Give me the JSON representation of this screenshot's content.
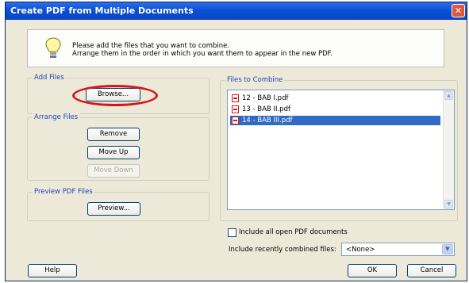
{
  "window": {
    "title": "Create PDF from Multiple Documents"
  },
  "info": {
    "line1": "Please add the files that you want to combine.",
    "line2": "Arrange them in the order in which you want them to appear in the new PDF."
  },
  "add_files": {
    "legend": "Add Files",
    "browse_label": "Browse..."
  },
  "arrange_files": {
    "legend": "Arrange Files",
    "remove_label": "Remove",
    "move_up_label": "Move Up",
    "move_down_label": "Move Down"
  },
  "preview": {
    "legend": "Preview PDF Files",
    "preview_label": "Preview..."
  },
  "files_to_combine": {
    "legend": "Files to Combine",
    "files": [
      "12 - BAB I.pdf",
      "13 - BAB II.pdf",
      "14 - BAB III.pdf"
    ],
    "selected_index": 2
  },
  "options": {
    "include_open_label": "Include all open PDF documents",
    "include_open_checked": false,
    "recent_label": "Include recently combined files:",
    "recent_value": "<None>"
  },
  "footer": {
    "help_label": "Help",
    "ok_label": "OK",
    "cancel_label": "Cancel"
  },
  "colors": {
    "title_bar": "#0a4fd6",
    "highlight_ring": "#d8141b",
    "selection": "#316ac5",
    "group_label": "#1e46b4"
  }
}
